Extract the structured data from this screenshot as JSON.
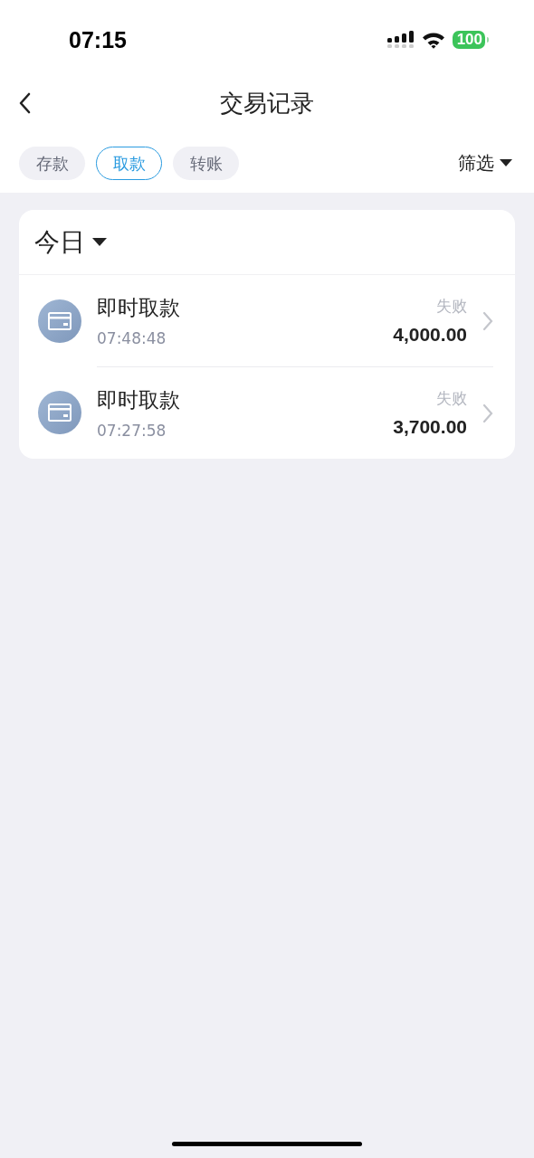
{
  "status_bar": {
    "time": "07:15",
    "battery": "100"
  },
  "nav": {
    "title": "交易记录"
  },
  "tabs": [
    {
      "label": "存款",
      "selected": false
    },
    {
      "label": "取款",
      "selected": true
    },
    {
      "label": "转账",
      "selected": false
    }
  ],
  "filter": {
    "label": "筛选"
  },
  "section": {
    "title": "今日"
  },
  "transactions": [
    {
      "title": "即时取款",
      "time": "07:48:48",
      "status": "失败",
      "amount": "4,000.00"
    },
    {
      "title": "即时取款",
      "time": "07:27:58",
      "status": "失败",
      "amount": "3,700.00"
    }
  ]
}
